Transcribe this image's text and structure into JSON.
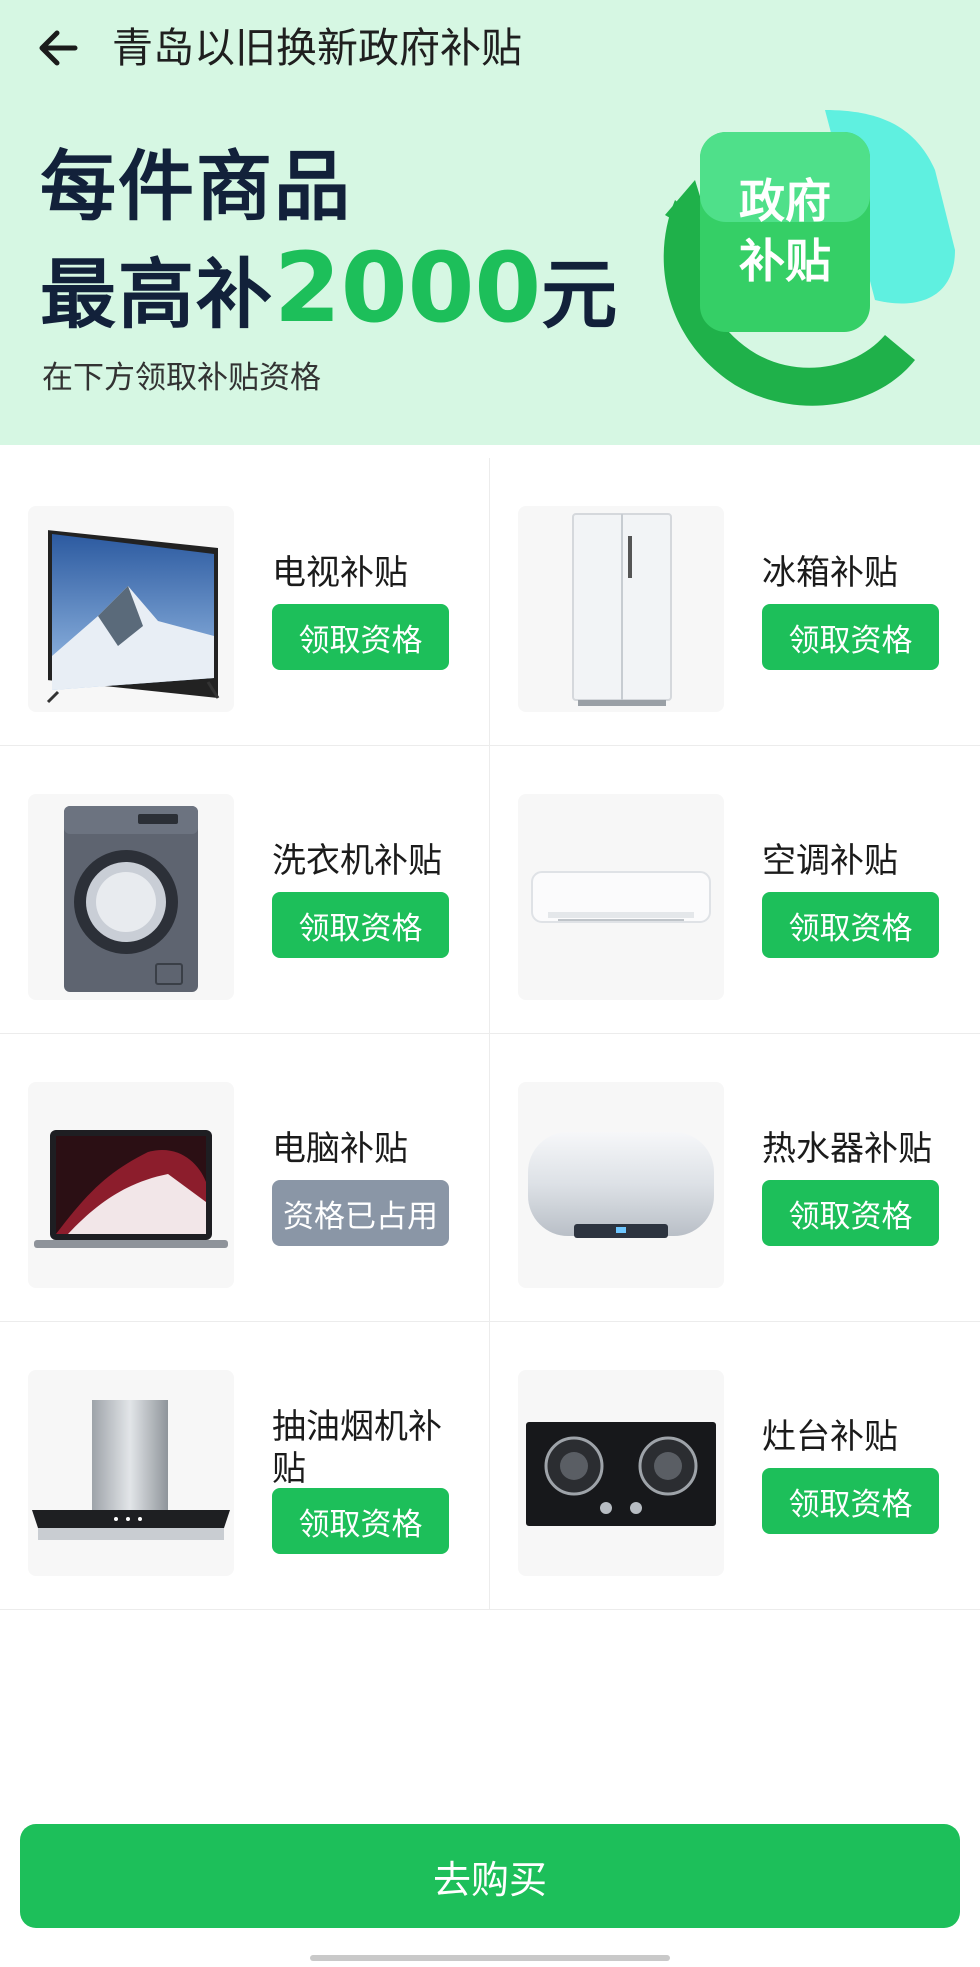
{
  "header": {
    "title": "青岛以旧换新政府补贴",
    "back_icon": "arrow-left-icon"
  },
  "hero": {
    "line1": "每件商品",
    "line2_prefix": "最高补",
    "line2_amount": "2000",
    "line2_unit": "元",
    "subtitle": "在下方领取补贴资格",
    "badge_line1": "政府",
    "badge_line2": "补贴",
    "accent_color": "#1dbf5a"
  },
  "products": [
    {
      "name": "电视补贴",
      "button": "领取资格",
      "disabled": false,
      "icon": "tv-icon"
    },
    {
      "name": "冰箱补贴",
      "button": "领取资格",
      "disabled": false,
      "icon": "fridge-icon"
    },
    {
      "name": "洗衣机补贴",
      "button": "领取资格",
      "disabled": false,
      "icon": "washing-machine-icon"
    },
    {
      "name": "空调补贴",
      "button": "领取资格",
      "disabled": false,
      "icon": "air-conditioner-icon"
    },
    {
      "name": "电脑补贴",
      "button": "资格已占用",
      "disabled": true,
      "icon": "laptop-icon"
    },
    {
      "name": "热水器补贴",
      "button": "领取资格",
      "disabled": false,
      "icon": "water-heater-icon"
    },
    {
      "name": "抽油烟机补贴",
      "button": "领取资格",
      "disabled": false,
      "icon": "range-hood-icon"
    },
    {
      "name": "灶台补贴",
      "button": "领取资格",
      "disabled": false,
      "icon": "gas-stove-icon"
    }
  ],
  "footer": {
    "buy_label": "去购买"
  },
  "colors": {
    "primary": "#1dbf5a",
    "disabled": "#8a96a6",
    "hero_bg": "#d6f7e3"
  }
}
